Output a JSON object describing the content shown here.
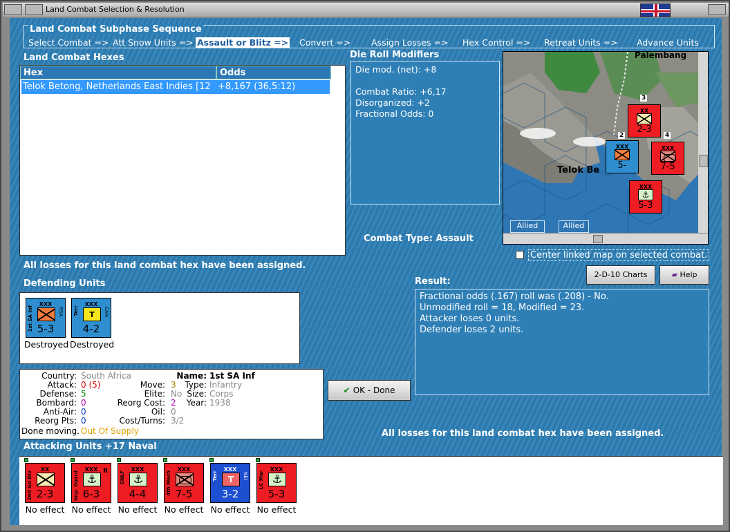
{
  "window": {
    "title": "Land Combat Selection & Resolution"
  },
  "subphase": {
    "title": "Land Combat Subphase Sequence",
    "steps": [
      "Select Combat =>",
      "Att Snow Units =>",
      "Assault or Blitz =>",
      "Convert =>",
      "Assign Losses =>",
      "Hex Control =>",
      "Retreat Units =>",
      "Advance Units"
    ]
  },
  "hexes": {
    "title": "Land Combat Hexes",
    "col_hex": "Hex",
    "col_odds": "Odds",
    "rows": [
      {
        "hex": "Telok Betong, Netherlands East Indies [12",
        "odds": "+8,167 (36,5:12)"
      }
    ]
  },
  "dieroll": {
    "title": "Die Roll Modifiers",
    "net": "Die mod. (net): +8",
    "ratio": "Combat Ratio: +6,17",
    "disorg": "Disorganized: +2",
    "frac": "Fractional Odds: 0"
  },
  "map": {
    "label_city": "Telok Be",
    "label_top": "Palembang",
    "tab1": "Allied",
    "tab2": "Allied",
    "stack_3": "3",
    "stack_2": "2",
    "stack_4": "4"
  },
  "combat_type": {
    "label": "Combat Type:",
    "value": "Assault"
  },
  "center_map": {
    "label": "Center linked map on selected combat."
  },
  "losses_msg": "All losses for this land combat hex have been assigned.",
  "buttons": {
    "charts": "2-D-10 Charts",
    "help": "Help",
    "ok": "OK - Done"
  },
  "result": {
    "title": "Result:",
    "lines": [
      "Fractional odds (.167) roll was (.208)  - No.",
      "Unmodified roll = 18, Modified = 23.",
      "Attacker loses 0 units.",
      "Defender loses 2 units."
    ]
  },
  "defending": {
    "title": "Defending Units",
    "units": [
      {
        "size": "XXX",
        "name": "1st SA Inf",
        "nat": "RSA",
        "val": "5-3",
        "status": "Destroyed"
      },
      {
        "size": "XXX",
        "name": "Terr",
        "nat": "CAN",
        "val": "4-2",
        "status": "Destroyed"
      }
    ]
  },
  "info": {
    "country_l": "Country:",
    "country": "South Africa",
    "attack_l": "Attack:",
    "attack": "0",
    "attack_paren": "(5)",
    "defense_l": "Defense:",
    "defense": "5",
    "bombard_l": "Bombard:",
    "bombard": "0",
    "antiair_l": "Anti-Air:",
    "antiair": "0",
    "reorg_l": "Reorg Pts:",
    "reorg": "0",
    "move_l": "Move:",
    "move": "3",
    "elite_l": "Elite:",
    "elite": "No",
    "reorgcost_l": "Reorg Cost:",
    "reorgcost": "2",
    "oil_l": "Oil:",
    "oil": "0",
    "cost_l": "Cost/Turns:",
    "cost": "3/2",
    "name_l": "Name:",
    "name": "1st SA Inf",
    "type_l": "Type:",
    "type": "Infantry",
    "size_l": "Size:",
    "size": "Corps",
    "year_l": "Year:",
    "year": "1938",
    "done": "Done moving.",
    "supply": "Out Of Supply"
  },
  "attacking": {
    "title": "Attacking Units +17 Naval",
    "units": [
      {
        "size": "XX",
        "name": "2nd Gd Div",
        "val": "2-3",
        "status": "No effect"
      },
      {
        "size": "XXX",
        "name": "Imp. Guard",
        "val": "6-3",
        "status": "No effect",
        "tag": "R"
      },
      {
        "size": "XXX",
        "name": "SNLF",
        "val": "4-4",
        "status": "No effect"
      },
      {
        "size": "XXX",
        "name": "4th Mech",
        "val": "7-5",
        "status": "No effect"
      },
      {
        "size": "XXX",
        "name": "Terr",
        "nat": "NEI",
        "val": "3-2",
        "status": "No effect"
      },
      {
        "size": "XXX",
        "name": "LC Mar",
        "val": "5-3",
        "status": "No effect"
      }
    ]
  },
  "map_units": [
    {
      "size": "XX",
      "val": "2-3"
    },
    {
      "size": "XXX",
      "val": "7-5"
    },
    {
      "size": "XXX",
      "val": "5-3"
    },
    {
      "size": "XXX",
      "val": "5-"
    }
  ]
}
